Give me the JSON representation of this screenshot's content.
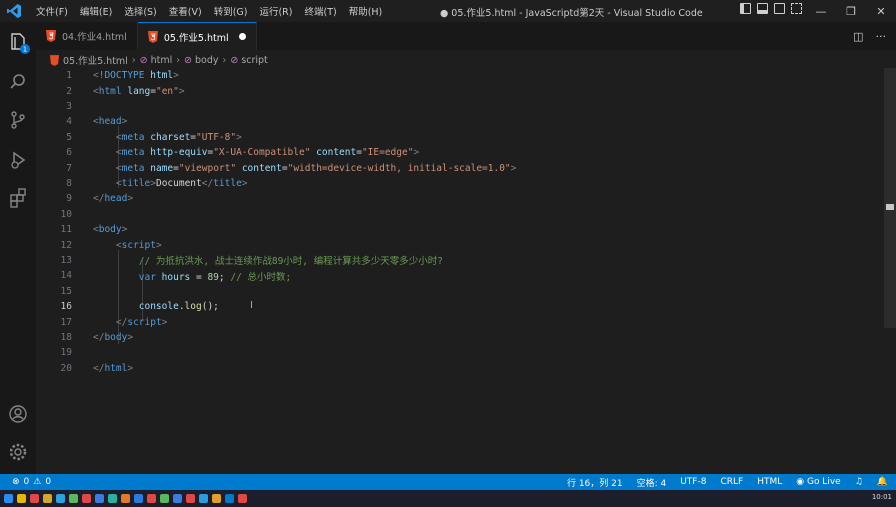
{
  "titlebar": {
    "menu": [
      "文件(F)",
      "编辑(E)",
      "选择(S)",
      "查看(V)",
      "转到(G)",
      "运行(R)",
      "终端(T)",
      "帮助(H)"
    ],
    "window_title": "● 05.作业5.html - JavaScriptd第2天 - Visual Studio Code"
  },
  "tabs": [
    {
      "label": "04.作业4.html",
      "active": false
    },
    {
      "label": "05.作业5.html",
      "active": true,
      "modified": true
    }
  ],
  "breadcrumb": [
    "05.作业5.html",
    "html",
    "body",
    "script"
  ],
  "editor": {
    "current_line": 16,
    "lines": [
      {
        "n": "1"
      },
      {
        "n": "2"
      },
      {
        "n": "3"
      },
      {
        "n": "4"
      },
      {
        "n": "5"
      },
      {
        "n": "6"
      },
      {
        "n": "7"
      },
      {
        "n": "8"
      },
      {
        "n": "9"
      },
      {
        "n": "10"
      },
      {
        "n": "11"
      },
      {
        "n": "12"
      },
      {
        "n": "13"
      },
      {
        "n": "14"
      },
      {
        "n": "15"
      },
      {
        "n": "16"
      },
      {
        "n": "17"
      },
      {
        "n": "18"
      },
      {
        "n": "19"
      },
      {
        "n": "20"
      }
    ],
    "code": {
      "doctype": "!DOCTYPE",
      "html_kw": "html",
      "html_tag": "html",
      "lang_attr": "lang",
      "lang_val": "\"en\"",
      "head": "head",
      "meta": "meta",
      "charset_attr": "charset",
      "charset_val": "\"UTF-8\"",
      "http_equiv_attr": "http-equiv",
      "http_equiv_val": "\"X-UA-Compatible\"",
      "content_attr": "content",
      "content_val1": "\"IE=edge\"",
      "name_attr": "name",
      "name_val": "\"viewport\"",
      "content_val2": "\"width=device-width, initial-scale=1.0\"",
      "title": "title",
      "title_text": "Document",
      "body": "body",
      "script": "script",
      "comment1": "// 为抵抗洪水, 战士连续作战89小时, 编程计算共多少天零多少小时?",
      "var_kw": "var",
      "hours": "hours",
      "eq": " = ",
      "num89": "89",
      "semi": ";",
      "comment2": "// 总小时数;",
      "console": "console",
      "log": "log",
      "call_end": "();"
    }
  },
  "statusbar": {
    "errors": "0",
    "warnings": "0",
    "position": "行 16，列 21",
    "spaces": "空格: 4",
    "encoding": "UTF-8",
    "eol": "CRLF",
    "language": "HTML",
    "golive": "Go Live"
  },
  "taskbar": {
    "clock": "10:01"
  },
  "colors": {
    "accent": "#007acc",
    "tab_border": "#0078d4"
  }
}
